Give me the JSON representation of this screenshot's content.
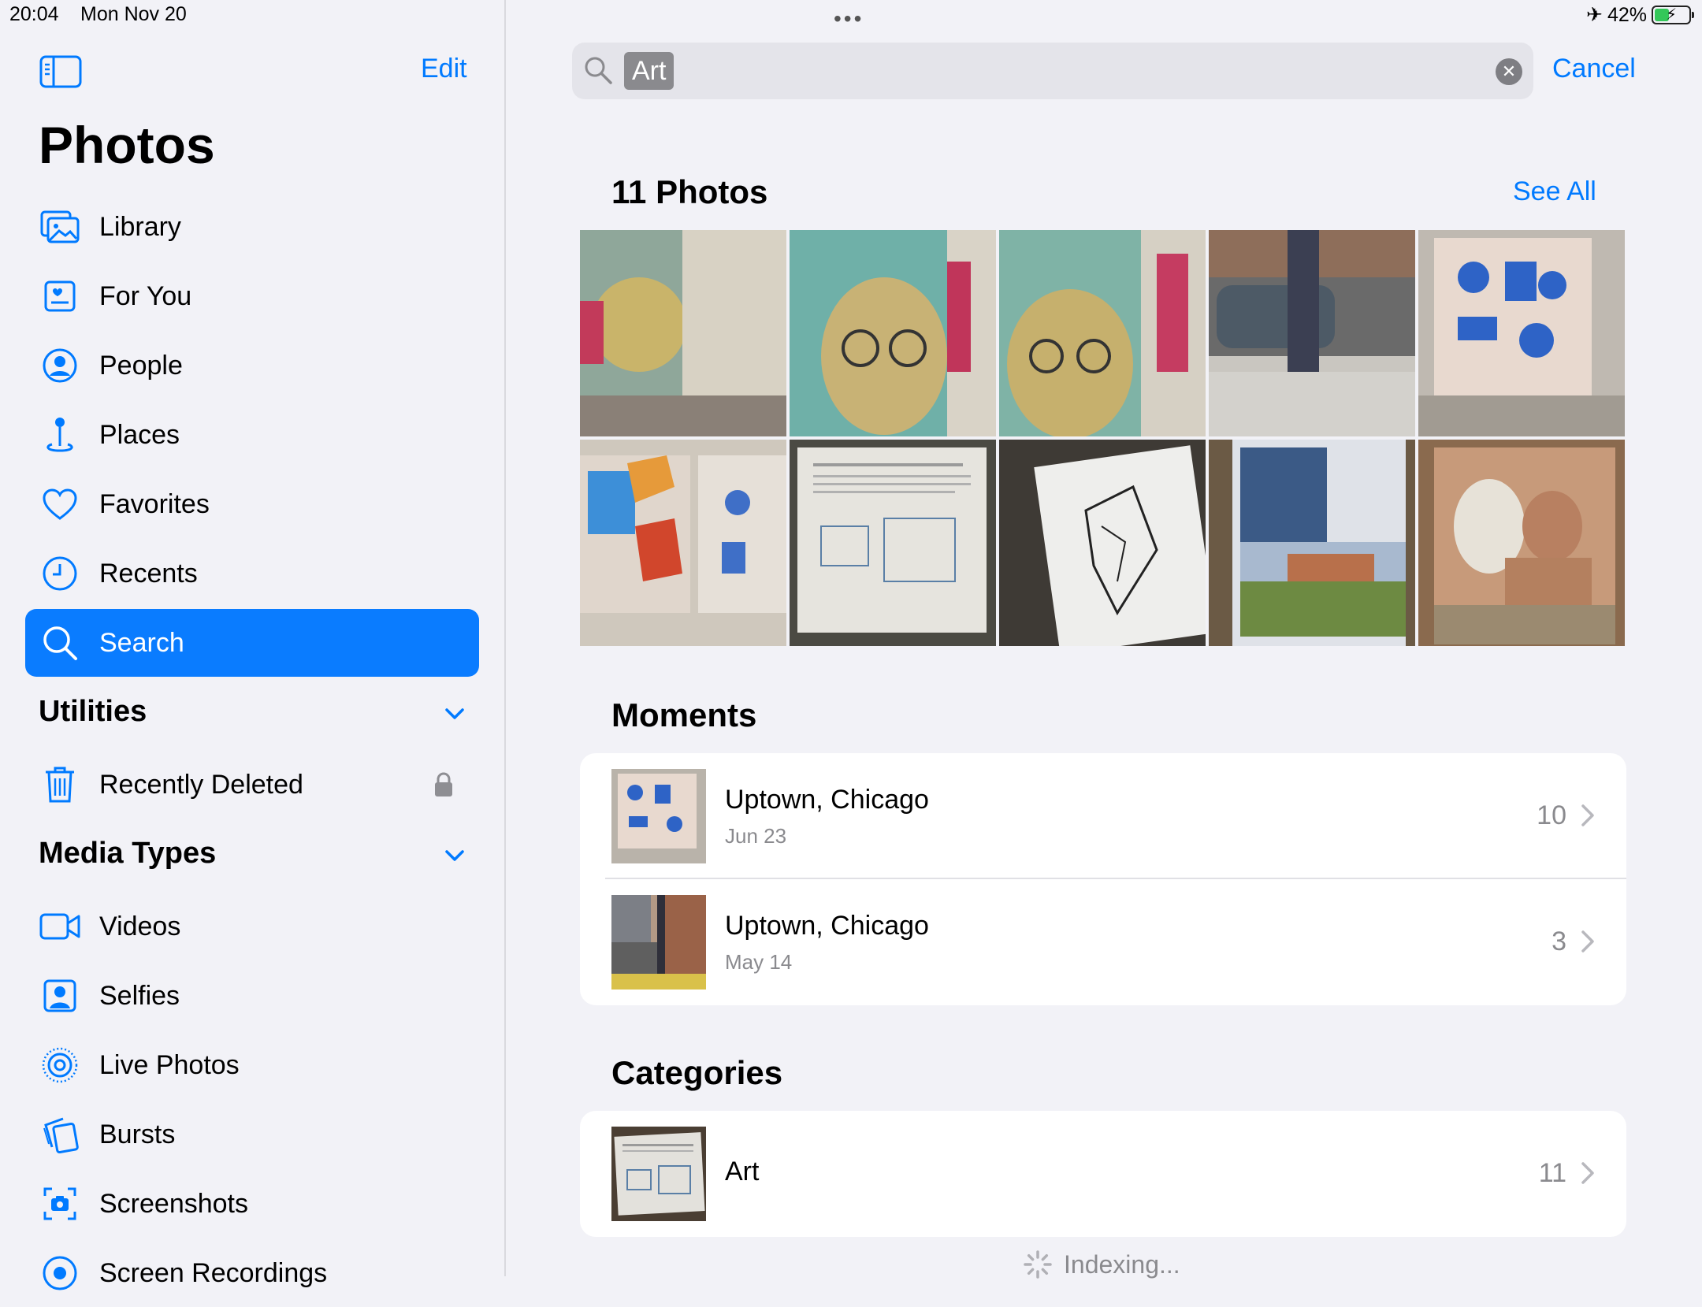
{
  "status": {
    "time": "20:04",
    "date": "Mon Nov 20",
    "battery": "42%",
    "battery_level": 0.42
  },
  "colors": {
    "accent": "#007aff",
    "active_bg": "#0a7cff"
  },
  "sidebar": {
    "edit": "Edit",
    "title": "Photos",
    "items": [
      {
        "label": "Library",
        "icon": "library-icon"
      },
      {
        "label": "For You",
        "icon": "for-you-icon"
      },
      {
        "label": "People",
        "icon": "people-icon"
      },
      {
        "label": "Places",
        "icon": "places-icon"
      },
      {
        "label": "Favorites",
        "icon": "heart-icon"
      },
      {
        "label": "Recents",
        "icon": "clock-icon"
      },
      {
        "label": "Search",
        "icon": "search-icon",
        "active": true
      }
    ],
    "utilities": {
      "title": "Utilities",
      "items": [
        {
          "label": "Recently Deleted",
          "icon": "trash-icon",
          "locked": true
        }
      ]
    },
    "media_types": {
      "title": "Media Types",
      "items": [
        {
          "label": "Videos",
          "icon": "video-icon"
        },
        {
          "label": "Selfies",
          "icon": "selfie-icon"
        },
        {
          "label": "Live Photos",
          "icon": "live-photo-icon"
        },
        {
          "label": "Bursts",
          "icon": "bursts-icon"
        },
        {
          "label": "Screenshots",
          "icon": "screenshot-icon"
        },
        {
          "label": "Screen Recordings",
          "icon": "screen-recording-icon"
        }
      ]
    }
  },
  "search": {
    "token": "Art",
    "cancel": "Cancel"
  },
  "photos": {
    "title": "11 Photos",
    "see_all": "See All",
    "thumbnails": [
      "mural-portrait-1",
      "mural-portrait-2",
      "mural-portrait-3",
      "street-pole-car",
      "blue-icons-box",
      "painted-box-corner",
      "document-page",
      "wolf-drawing",
      "magazine-field",
      "man-with-dog"
    ]
  },
  "moments": {
    "title": "Moments",
    "items": [
      {
        "title": "Uptown, Chicago",
        "date": "Jun 23",
        "count": "10"
      },
      {
        "title": "Uptown, Chicago",
        "date": "May 14",
        "count": "3"
      }
    ]
  },
  "categories": {
    "title": "Categories",
    "items": [
      {
        "title": "Art",
        "count": "11"
      }
    ]
  },
  "indexing": "Indexing..."
}
